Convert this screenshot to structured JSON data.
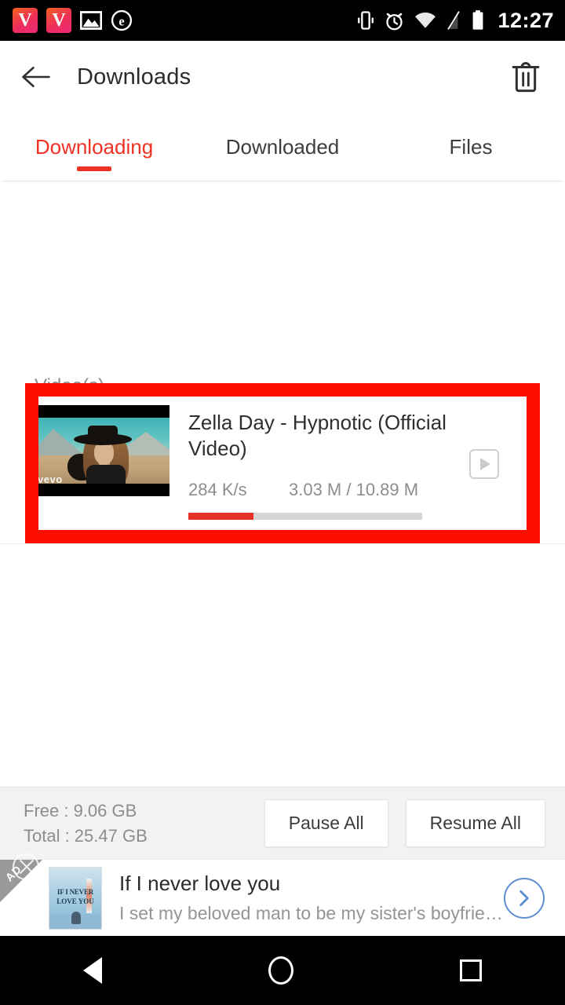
{
  "status_bar": {
    "time": "12:27",
    "left_icons": [
      {
        "name": "vidmate-app-icon",
        "glyph": "V"
      },
      {
        "name": "vidmate-app-icon-2",
        "glyph": "V"
      },
      {
        "name": "image-icon",
        "glyph": "image"
      },
      {
        "name": "browser-e-icon",
        "glyph": "e"
      }
    ],
    "right_icons": [
      {
        "name": "vibrate-icon"
      },
      {
        "name": "alarm-icon"
      },
      {
        "name": "wifi-icon"
      },
      {
        "name": "signal-off-icon"
      },
      {
        "name": "battery-icon"
      }
    ]
  },
  "header": {
    "title": "Downloads",
    "back_icon": "arrow-left-icon",
    "delete_icon": "trash-icon"
  },
  "tabs": {
    "active_index": 0,
    "items": [
      {
        "label": "Downloading"
      },
      {
        "label": "Downloaded"
      },
      {
        "label": "Files"
      }
    ],
    "active_color": "#ef3124"
  },
  "content": {
    "section_label": "Video(s)",
    "download": {
      "title": "Zella Day - Hypnotic (Official Video)",
      "speed": "284 K/s",
      "size": "3.03 M / 10.89 M",
      "progress_percent": 27.8,
      "thumbnail_watermark": "vevo",
      "play_icon": "play-icon",
      "menu_icon": "more-vertical-icon"
    }
  },
  "annotation": {
    "color": "#fb0d00",
    "target": "download-item-card"
  },
  "footer": {
    "free_label": "Free : 9.06 GB",
    "total_label": "Total : 25.47 GB",
    "pause_all": "Pause All",
    "resume_all": "Resume All"
  },
  "ad": {
    "badge": "AD",
    "title": "If I never love you",
    "description": "I set my beloved man to be my sister's boyfrie…",
    "cover_line1": "IF I NEVER",
    "cover_line2": "LOVE YOU",
    "cta_icon": "chevron-right-icon",
    "cta_color": "#5b8fd0"
  },
  "nav_bar": {
    "back": "back-triangle-icon",
    "home": "home-circle-icon",
    "recents": "recents-square-icon"
  }
}
